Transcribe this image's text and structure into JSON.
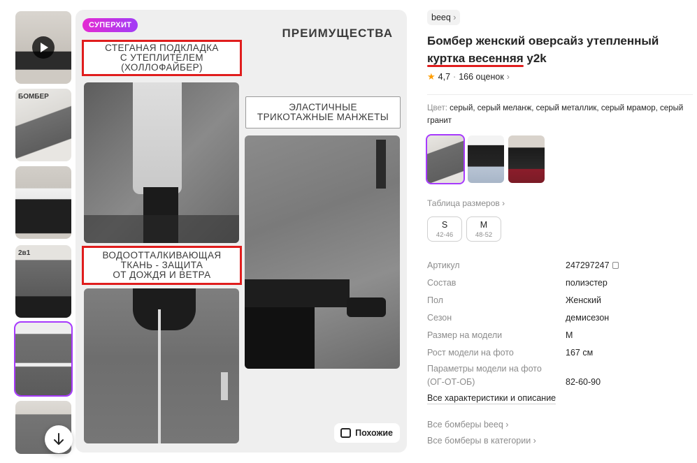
{
  "thumbnails": [
    {
      "kind": "video",
      "text": ""
    },
    {
      "kind": "image",
      "text": "БОМБЕР"
    },
    {
      "kind": "image",
      "text": ""
    },
    {
      "kind": "image",
      "text": "2в1"
    },
    {
      "kind": "image",
      "text": ""
    },
    {
      "kind": "image",
      "text": ""
    }
  ],
  "main": {
    "badge": "СУПЕРХИТ",
    "title": "ПРЕИМУЩЕСТВА",
    "callout1": "СТЕГАНАЯ ПОДКЛАДКА\nС УТЕПЛИТЕЛЕМ\n(ХОЛЛОФАЙБЕР)",
    "callout2": "ЭЛАСТИЧНЫЕ\nТРИКОТАЖНЫЕ  МАНЖЕТЫ",
    "callout3": "ВОДООТТАЛКИВАЮЩАЯ\nТКАНЬ - ЗАЩИТА\nОТ ДОЖДЯ И ВЕТРА",
    "similar": "Похожие"
  },
  "product": {
    "brand": "beeq",
    "title_a": "Бомбер женский оверсайз утепленный",
    "title_b": "куртка весенняя",
    "title_c": " y2k",
    "rating": "4,7",
    "reviews": "166 оценок",
    "color_label": "Цвет:",
    "colors": "серый, серый меланж, серый металлик, серый мрамор, серый гранит",
    "size_table": "Таблица размеров",
    "sizes": [
      {
        "name": "S",
        "range": "42-46"
      },
      {
        "name": "M",
        "range": "48-52"
      }
    ],
    "specs": [
      {
        "k": "Артикул",
        "v": "247297247"
      },
      {
        "k": "Состав",
        "v": "полиэстер"
      },
      {
        "k": "Пол",
        "v": "Женский"
      },
      {
        "k": "Сезон",
        "v": "демисезон"
      },
      {
        "k": "Размер на модели",
        "v": "M"
      },
      {
        "k": "Рост модели на фото",
        "v": "167 см"
      }
    ],
    "params_k1": "Параметры модели на фото",
    "params_k2": "(ОГ-ОТ-ОБ)",
    "params_v": "82-60-90",
    "all_chars": "Все характеристики и описание",
    "link_brand": "Все бомберы beeq",
    "link_cat": "Все бомберы в категории"
  },
  "colors": {
    "accent": "#a73afd",
    "badge_from": "#e42ad2",
    "badge_to": "#a13cf6",
    "highlight": "#e01d1d",
    "star": "#ff9d00"
  }
}
